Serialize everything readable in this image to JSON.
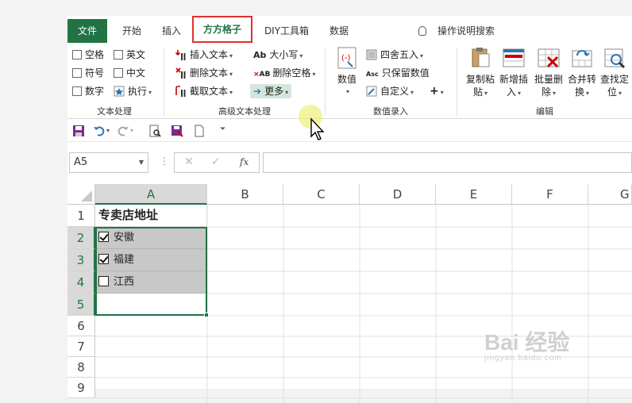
{
  "tabs": {
    "file": "文件",
    "home": "开始",
    "insert": "插入",
    "ffgz": "方方格子",
    "diy": "DIY工具箱",
    "data": "数据",
    "tell_me": "操作说明搜索"
  },
  "ribbon": {
    "text_processing": {
      "label": "文本处理",
      "space": "空格",
      "english": "英文",
      "symbol": "符号",
      "chinese": "中文",
      "number": "数字",
      "execute": "执行"
    },
    "advanced_text": {
      "label": "高级文本处理",
      "insert_text": "插入文本",
      "delete_text": "删除文本",
      "extract_text": "截取文本",
      "case": "大小写",
      "delete_space": "删除空格",
      "more": "更多"
    },
    "numeric_entry": {
      "label": "数值录入",
      "value": "数值",
      "round": "四舍五入",
      "keep_value": "只保留数值",
      "custom": "自定义",
      "plus": "+"
    },
    "edit": {
      "label": "编辑",
      "copy_paste": [
        "复制粘",
        "贴"
      ],
      "add_insert": [
        "新增插",
        "入"
      ],
      "batch_delete": [
        "批量删",
        "除"
      ],
      "merge_convert": [
        "合并转",
        "换"
      ],
      "find_locate": [
        "查找定",
        "位"
      ]
    }
  },
  "formula_bar": {
    "name_box": "A5",
    "fx": "fx"
  },
  "sheet": {
    "columns": [
      "A",
      "B",
      "C",
      "D",
      "E",
      "F",
      "G"
    ],
    "rows": [
      "1",
      "2",
      "3",
      "4",
      "5",
      "6",
      "7",
      "8",
      "9"
    ],
    "a1": "专卖店地址",
    "items": [
      {
        "label": "安徽",
        "checked": true
      },
      {
        "label": "福建",
        "checked": true
      },
      {
        "label": "江西",
        "checked": false
      }
    ]
  },
  "watermark": {
    "brand": "Bai 经验",
    "url": "jingyan.baidu.com"
  },
  "colors": {
    "accent": "#217346",
    "highlight_border": "#e03030"
  }
}
